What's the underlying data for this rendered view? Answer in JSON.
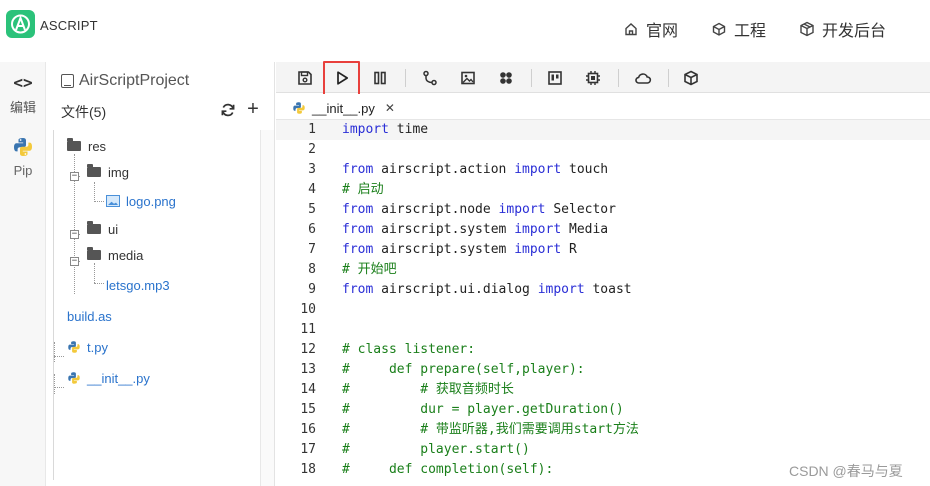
{
  "header": {
    "brand": "ASCRIPT",
    "nav": [
      {
        "label": "官网",
        "icon": "home-icon"
      },
      {
        "label": "工程",
        "icon": "cube-icon"
      },
      {
        "label": "开发后台",
        "icon": "cubes-icon"
      }
    ]
  },
  "iconbar": {
    "items": [
      {
        "glyph": "<>",
        "label": "编辑",
        "icon": "code-icon"
      },
      {
        "label": "Pip",
        "icon": "python-icon"
      }
    ]
  },
  "filepanel": {
    "project_name": "AirScriptProject",
    "files_label": "文件(5)",
    "add_symbol": "+",
    "tree": [
      {
        "name": "res",
        "type": "folder"
      },
      {
        "name": "img",
        "type": "folder"
      },
      {
        "name": "logo.png",
        "type": "file"
      },
      {
        "name": "ui",
        "type": "folder"
      },
      {
        "name": "media",
        "type": "folder"
      },
      {
        "name": "letsgo.mp3",
        "type": "file"
      },
      {
        "name": "build.as",
        "type": "file"
      },
      {
        "name": "t.py",
        "type": "file"
      },
      {
        "name": "__init__.py",
        "type": "file"
      }
    ]
  },
  "toolbar": {
    "buttons": [
      "save-icon",
      "run-icon",
      "pause-icon",
      "branch-icon",
      "image-icon",
      "plugin-icon",
      "layout-icon",
      "chip-icon",
      "cloud-icon",
      "package-icon"
    ],
    "highlighted": "run-icon",
    "highlight_color": "#e8403c"
  },
  "tabs": [
    {
      "label": "__init__.py",
      "close": "✕"
    }
  ],
  "editor": {
    "lines": [
      {
        "n": "1",
        "parts": [
          [
            "kw",
            "import"
          ],
          [
            "",
            " time"
          ]
        ]
      },
      {
        "n": "2",
        "parts": []
      },
      {
        "n": "3",
        "parts": [
          [
            "kw",
            "from"
          ],
          [
            "",
            " airscript.action "
          ],
          [
            "kw",
            "import"
          ],
          [
            "",
            " touch"
          ]
        ]
      },
      {
        "n": "4",
        "parts": [
          [
            "cm",
            "# 启动"
          ]
        ]
      },
      {
        "n": "5",
        "parts": [
          [
            "kw",
            "from"
          ],
          [
            "",
            " airscript.node "
          ],
          [
            "kw",
            "import"
          ],
          [
            "",
            " Selector"
          ]
        ]
      },
      {
        "n": "6",
        "parts": [
          [
            "kw",
            "from"
          ],
          [
            "",
            " airscript.system "
          ],
          [
            "kw",
            "import"
          ],
          [
            "",
            " Media"
          ]
        ]
      },
      {
        "n": "7",
        "parts": [
          [
            "kw",
            "from"
          ],
          [
            "",
            " airscript.system "
          ],
          [
            "kw",
            "import"
          ],
          [
            "",
            " R"
          ]
        ]
      },
      {
        "n": "8",
        "parts": [
          [
            "cm",
            "# 开始吧"
          ]
        ]
      },
      {
        "n": "9",
        "parts": [
          [
            "kw",
            "from"
          ],
          [
            "",
            " airscript.ui.dialog "
          ],
          [
            "kw",
            "import"
          ],
          [
            "",
            " toast"
          ]
        ]
      },
      {
        "n": "10",
        "parts": []
      },
      {
        "n": "11",
        "parts": []
      },
      {
        "n": "12",
        "parts": [
          [
            "cm",
            "# class listener:"
          ]
        ]
      },
      {
        "n": "13",
        "parts": [
          [
            "cm",
            "#     def prepare(self,player):"
          ]
        ]
      },
      {
        "n": "14",
        "parts": [
          [
            "cm",
            "#         # 获取音频时长"
          ]
        ]
      },
      {
        "n": "15",
        "parts": [
          [
            "cm",
            "#         dur = player.getDuration()"
          ]
        ]
      },
      {
        "n": "16",
        "parts": [
          [
            "cm",
            "#         # 带监听器,我们需要调用start方法"
          ]
        ]
      },
      {
        "n": "17",
        "parts": [
          [
            "cm",
            "#         player.start()"
          ]
        ]
      },
      {
        "n": "18",
        "parts": [
          [
            "cm",
            "#     def completion(self):"
          ]
        ]
      }
    ]
  },
  "watermark": "CSDN @春马与夏",
  "colors": {
    "brand": "#2bc27a",
    "keyword": "#2a2ed6",
    "comment": "#1a7f1a",
    "file_link": "#2a73cc"
  }
}
